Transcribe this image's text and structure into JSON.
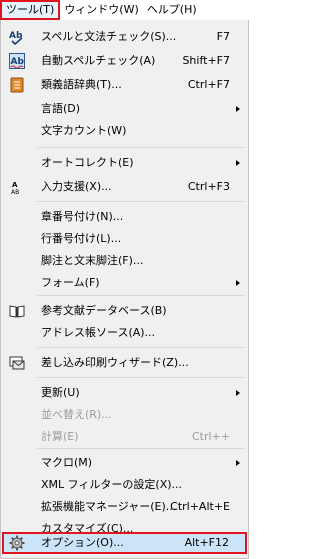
{
  "menubar": {
    "tools": "ツール(T)",
    "window": "ウィンドウ(W)",
    "help": "ヘルプ(H)"
  },
  "menu": {
    "spelling": {
      "label": "スペルと文法チェック(S)...",
      "shortcut": "F7"
    },
    "autospell": {
      "label": "自動スペルチェック(A)",
      "shortcut": "Shift+F7"
    },
    "thesaurus": {
      "label": "類義語辞典(T)...",
      "shortcut": "Ctrl+F7"
    },
    "language": {
      "label": "言語(D)"
    },
    "wordcount": {
      "label": "文字カウント(W)"
    },
    "autocorrect": {
      "label": "オートコレクト(E)"
    },
    "input_support": {
      "label": "入力支援(X)...",
      "shortcut": "Ctrl+F3"
    },
    "chapter_numbering": {
      "label": "章番号付け(N)..."
    },
    "line_numbering": {
      "label": "行番号付け(L)..."
    },
    "footnotes": {
      "label": "脚注と文末脚注(F)..."
    },
    "forms": {
      "label": "フォーム(F)"
    },
    "bibliography": {
      "label": "参考文献データベース(B)"
    },
    "address_source": {
      "label": "アドレス帳ソース(A)..."
    },
    "mail_merge": {
      "label": "差し込み印刷ウィザード(Z)..."
    },
    "update": {
      "label": "更新(U)"
    },
    "sort": {
      "label": "並べ替え(R)..."
    },
    "calculate": {
      "label": "計算(E)",
      "shortcut": "Ctrl++"
    },
    "macros": {
      "label": "マクロ(M)"
    },
    "xml_filter": {
      "label": "XML フィルターの設定(X)..."
    },
    "extensions": {
      "label": "拡張機能マネージャー(E)...",
      "shortcut": "Ctrl+Alt+E"
    },
    "customize": {
      "label": "カスタマイズ(C)..."
    },
    "options": {
      "label": "オプション(O)...",
      "shortcut": "Alt+F12"
    }
  }
}
